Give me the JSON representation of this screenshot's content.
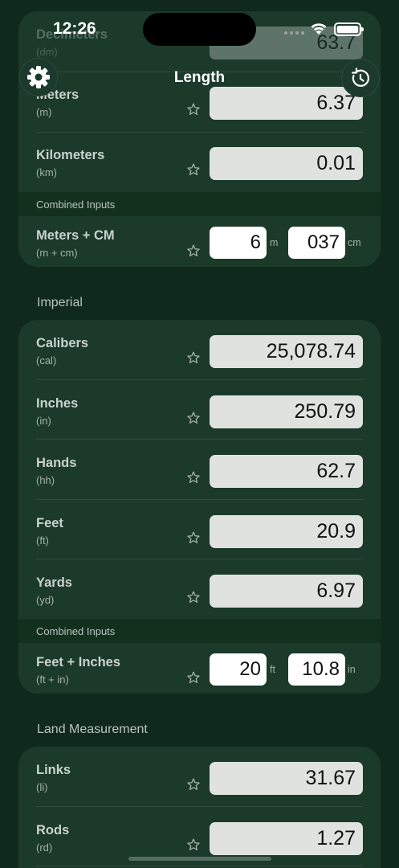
{
  "status_bar": {
    "time": "12:26"
  },
  "nav": {
    "title": "Length"
  },
  "metric_card": {
    "partial_top_row": {
      "name": "Decimeters",
      "abbr": "(dm)",
      "value": "63.7"
    },
    "rows": [
      {
        "name": "Meters",
        "abbr": "(m)",
        "value": "6.37"
      },
      {
        "name": "Kilometers",
        "abbr": "(km)",
        "value": "0.01"
      }
    ],
    "combined_header": "Combined Inputs",
    "combined": {
      "name": "Meters + CM",
      "abbr": "(m + cm)",
      "value1": "6",
      "unit1": "m",
      "value2": "037",
      "unit2": "cm"
    }
  },
  "imperial": {
    "section_title": "Imperial",
    "rows": [
      {
        "name": "Calibers",
        "abbr": "(cal)",
        "value": "25,078.74"
      },
      {
        "name": "Inches",
        "abbr": "(in)",
        "value": "250.79"
      },
      {
        "name": "Hands",
        "abbr": "(hh)",
        "value": "62.7"
      },
      {
        "name": "Feet",
        "abbr": "(ft)",
        "value": "20.9"
      },
      {
        "name": "Yards",
        "abbr": "(yd)",
        "value": "6.97"
      }
    ],
    "combined_header": "Combined Inputs",
    "combined": {
      "name": "Feet + Inches",
      "abbr": "(ft + in)",
      "value1": "20",
      "unit1": "ft",
      "value2": "10.8",
      "unit2": "in"
    }
  },
  "land": {
    "section_title": "Land Measurement",
    "rows": [
      {
        "name": "Links",
        "abbr": "(li)",
        "value": "31.67"
      },
      {
        "name": "Rods",
        "abbr": "(rd)",
        "value": "1.27"
      }
    ]
  },
  "colors": {
    "background": "#0f2a1d",
    "card": "#1b3a2a",
    "header_strip": "#13301f",
    "value_box": "#e0e2e0"
  }
}
